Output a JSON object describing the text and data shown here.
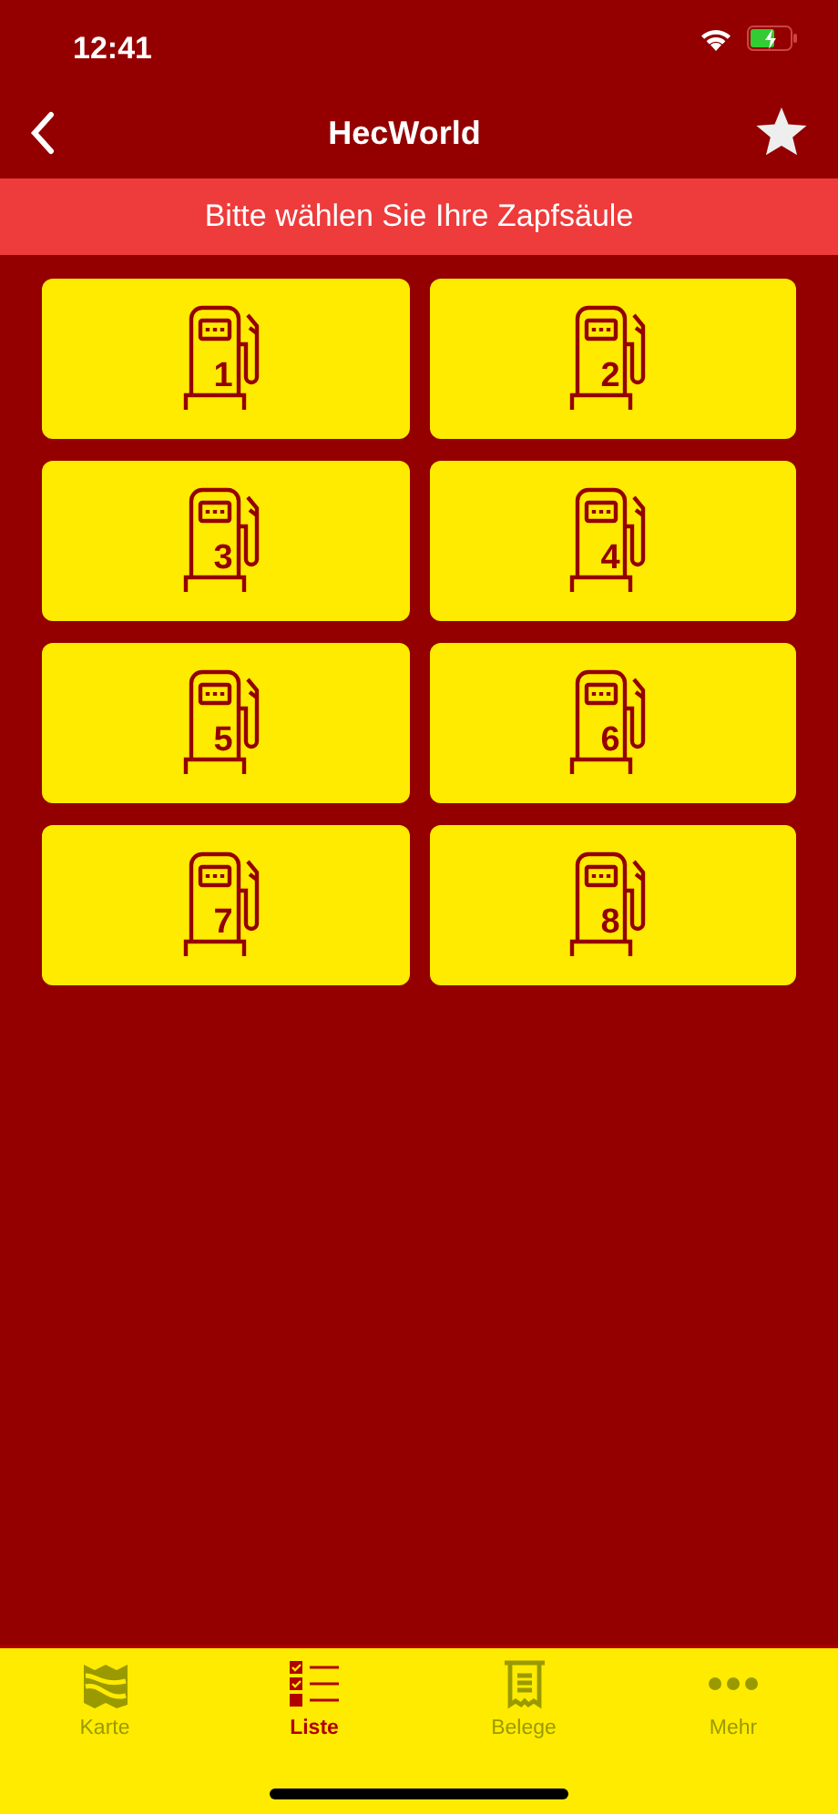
{
  "status_bar": {
    "time": "12:41"
  },
  "nav": {
    "title": "HecWorld"
  },
  "banner": {
    "text": "Bitte wählen Sie Ihre Zapfsäule"
  },
  "pumps": [
    {
      "number": "1"
    },
    {
      "number": "2"
    },
    {
      "number": "3"
    },
    {
      "number": "4"
    },
    {
      "number": "5"
    },
    {
      "number": "6"
    },
    {
      "number": "7"
    },
    {
      "number": "8"
    }
  ],
  "tabs": [
    {
      "kind": "map",
      "label": "Karte",
      "selected": false
    },
    {
      "kind": "list",
      "label": "Liste",
      "selected": true
    },
    {
      "kind": "receipt",
      "label": "Belege",
      "selected": false
    },
    {
      "kind": "more",
      "label": "Mehr",
      "selected": false
    }
  ]
}
